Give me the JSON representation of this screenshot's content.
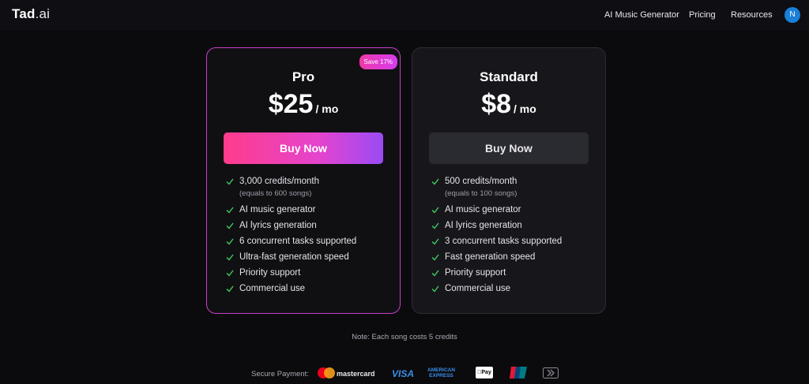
{
  "header": {
    "logo_bold": "Tad",
    "logo_light": ".ai",
    "nav": [
      "AI Music Generator",
      "Pricing",
      "Resources"
    ],
    "avatar_initial": "N"
  },
  "plans": [
    {
      "name": "Pro",
      "price": "$25",
      "per": "/ mo",
      "badge": "Save 17%",
      "button": "Buy Now",
      "features": [
        {
          "text": "3,000 credits/month",
          "sub": "(equals to 600 songs)"
        },
        {
          "text": "AI music generator"
        },
        {
          "text": "AI lyrics generation"
        },
        {
          "text": "6 concurrent tasks supported"
        },
        {
          "text": "Ultra-fast generation speed"
        },
        {
          "text": "Priority support"
        },
        {
          "text": "Commercial use"
        }
      ]
    },
    {
      "name": "Standard",
      "price": "$8",
      "per": "/ mo",
      "button": "Buy Now",
      "features": [
        {
          "text": "500 credits/month",
          "sub": "(equals to 100 songs)"
        },
        {
          "text": "AI music generator"
        },
        {
          "text": "AI lyrics generation"
        },
        {
          "text": "3 concurrent tasks supported"
        },
        {
          "text": "Fast generation speed"
        },
        {
          "text": "Priority support"
        },
        {
          "text": "Commercial use"
        }
      ]
    }
  ],
  "note": "Note: Each song costs 5 credits",
  "payment": {
    "label": "Secure Payment:",
    "mastercard": "mastercard",
    "visa": "VISA",
    "amex_line1": "AMERICAN",
    "amex_line2": "EXPRESS",
    "applepay": "Pay"
  },
  "colors": {
    "check": "#3ecf5e",
    "pro_border": "#c93fc9",
    "avatar": "#1a7fd8"
  }
}
